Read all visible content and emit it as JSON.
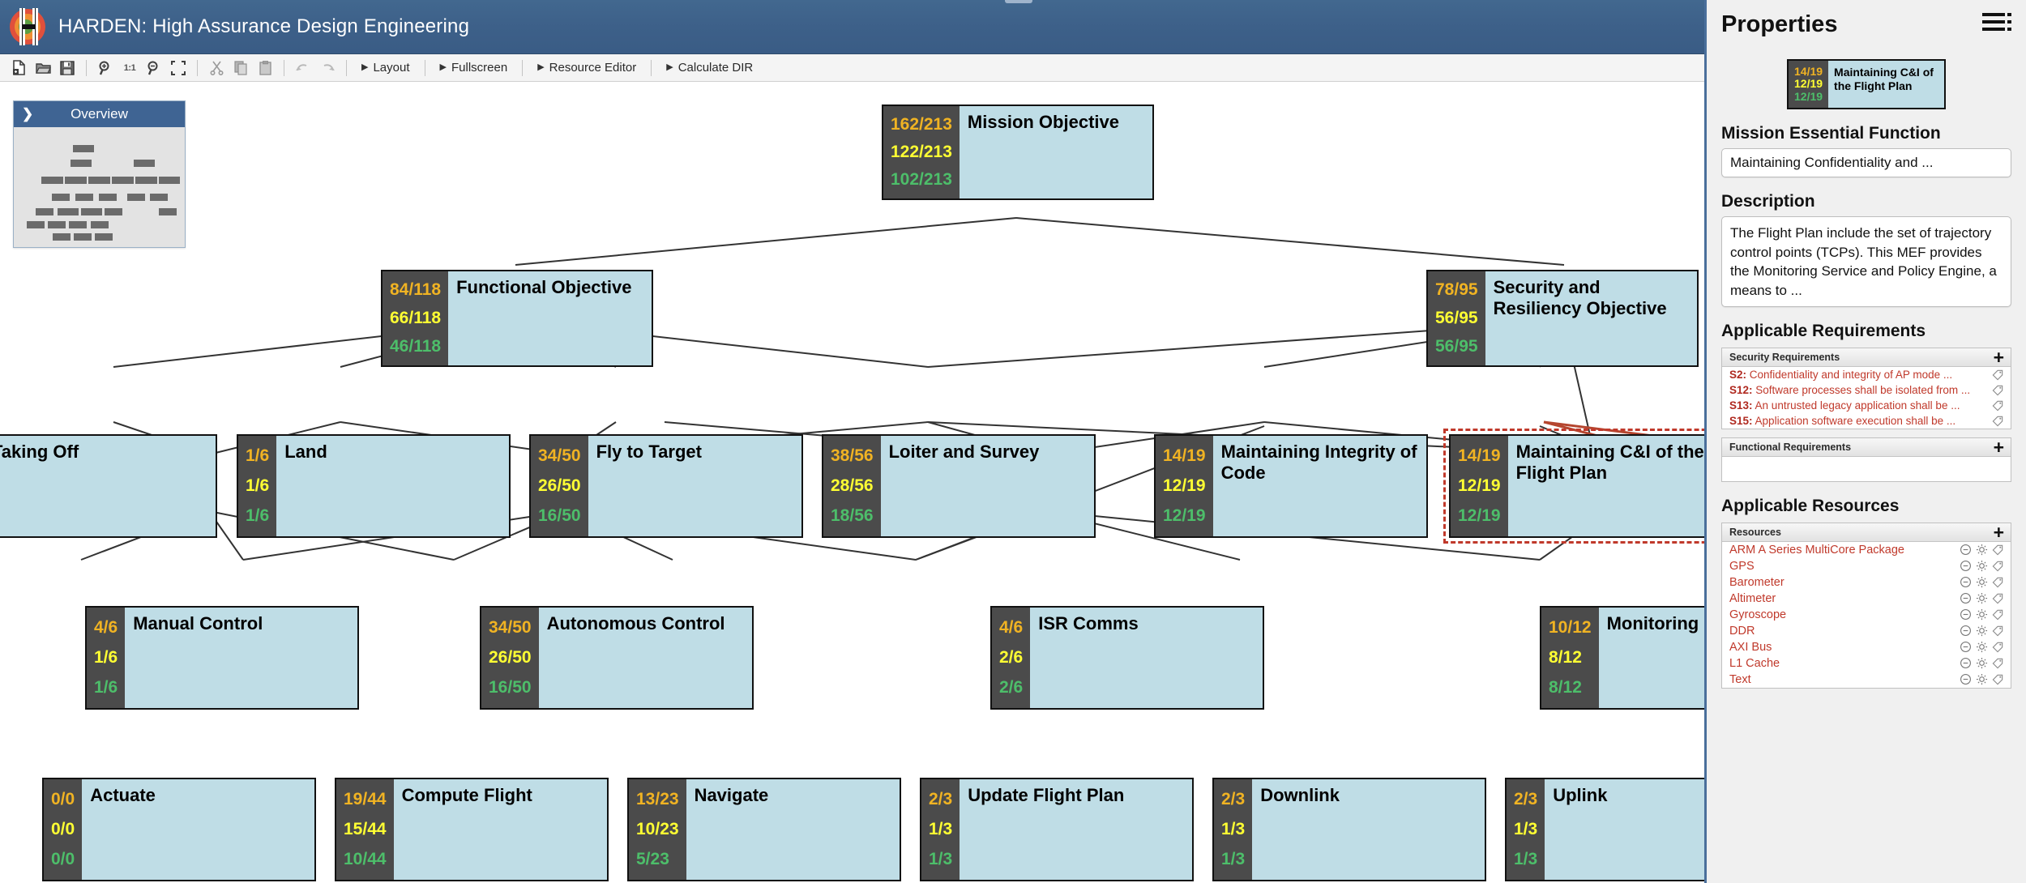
{
  "app": {
    "title": "HARDEN: High Assurance Design Engineering",
    "logo_icon": "harden-logo-icon"
  },
  "toolbar": {
    "icon_buttons": [
      {
        "name": "new-file-icon",
        "tooltip": "New"
      },
      {
        "name": "open-folder-icon",
        "tooltip": "Open"
      },
      {
        "name": "save-disk-icon",
        "tooltip": "Save"
      },
      {
        "name": "zoom-in-icon",
        "tooltip": "Zoom In"
      },
      {
        "name": "zoom-actual-size-icon",
        "tooltip": "1:1",
        "text": "1:1"
      },
      {
        "name": "zoom-out-icon",
        "tooltip": "Zoom Out"
      },
      {
        "name": "fit-to-screen-icon",
        "tooltip": "Fit"
      },
      {
        "name": "cut-scissors-icon",
        "tooltip": "Cut"
      },
      {
        "name": "copy-icon",
        "tooltip": "Copy"
      },
      {
        "name": "paste-icon",
        "tooltip": "Paste"
      },
      {
        "name": "undo-icon",
        "tooltip": "Undo"
      },
      {
        "name": "redo-icon",
        "tooltip": "Redo"
      }
    ],
    "menus": [
      {
        "label": "Layout"
      },
      {
        "label": "Fullscreen"
      },
      {
        "label": "Resource Editor"
      },
      {
        "label": "Calculate DIR"
      }
    ]
  },
  "overview": {
    "title": "Overview",
    "chevron_icon": "chevron-right-icon"
  },
  "diagram": {
    "nodes": [
      {
        "id": "mission-objective",
        "label": "Mission Objective",
        "m1": "162/213",
        "m2": "122/213",
        "m3": "102/213"
      },
      {
        "id": "functional-objective",
        "label": "Functional Objective",
        "m1": "84/118",
        "m2": "66/118",
        "m3": "46/118"
      },
      {
        "id": "security-resiliency-objective",
        "label": "Security and Resiliency Objective",
        "m1": "78/95",
        "m2": "56/95",
        "m3": "56/95"
      },
      {
        "id": "taking-off",
        "label": "Taking Off",
        "m1": "",
        "m2": "",
        "m3": ""
      },
      {
        "id": "land",
        "label": "Land",
        "m1": "1/6",
        "m2": "1/6",
        "m3": "1/6"
      },
      {
        "id": "fly-to-target",
        "label": "Fly to Target",
        "m1": "34/50",
        "m2": "26/50",
        "m3": "16/50"
      },
      {
        "id": "loiter-and-survey",
        "label": "Loiter and Survey",
        "m1": "38/56",
        "m2": "28/56",
        "m3": "18/56"
      },
      {
        "id": "maintaining-integrity-of-code",
        "label": "Maintaining Integrity of Code",
        "m1": "14/19",
        "m2": "12/19",
        "m3": "12/19"
      },
      {
        "id": "maintaining-ci-flight-plan",
        "label": "Maintaining C&I of the Flight Plan",
        "m1": "14/19",
        "m2": "12/19",
        "m3": "12/19",
        "selected": true
      },
      {
        "id": "manual-control",
        "label": "Manual Control",
        "m1": "4/6",
        "m2": "1/6",
        "m3": "1/6"
      },
      {
        "id": "autonomous-control",
        "label": "Autonomous Control",
        "m1": "34/50",
        "m2": "26/50",
        "m3": "16/50"
      },
      {
        "id": "isr-comms",
        "label": "ISR Comms",
        "m1": "4/6",
        "m2": "2/6",
        "m3": "2/6"
      },
      {
        "id": "monitoring",
        "label": "Monitoring",
        "m1": "10/12",
        "m2": "8/12",
        "m3": "8/12"
      },
      {
        "id": "actuate",
        "label": "Actuate",
        "m1": "0/0",
        "m2": "0/0",
        "m3": "0/0"
      },
      {
        "id": "compute-flight",
        "label": "Compute Flight",
        "m1": "19/44",
        "m2": "15/44",
        "m3": "10/44"
      },
      {
        "id": "navigate",
        "label": "Navigate",
        "m1": "13/23",
        "m2": "10/23",
        "m3": "5/23"
      },
      {
        "id": "update-flight-plan",
        "label": "Update Flight Plan",
        "m1": "2/3",
        "m2": "1/3",
        "m3": "1/3"
      },
      {
        "id": "downlink",
        "label": "Downlink",
        "m1": "2/3",
        "m2": "1/3",
        "m3": "1/3"
      },
      {
        "id": "uplink",
        "label": "Uplink",
        "m1": "2/3",
        "m2": "1/3",
        "m3": "1/3"
      }
    ]
  },
  "properties": {
    "title": "Properties",
    "menu_icon": "hamburger-menu-icon",
    "preview": {
      "label": "Maintaining C&I of the Flight Plan",
      "m1": "14/19",
      "m2": "12/19",
      "m3": "12/19"
    },
    "mef": {
      "heading": "Mission Essential Function",
      "value": "Maintaining Confidentiality and ..."
    },
    "description": {
      "heading": "Description",
      "value": "The Flight Plan include the set of trajectory control points (TCPs). This MEF provides the Monitoring Service and Policy Engine, a means to ..."
    },
    "applicable_requirements": {
      "heading": "Applicable Requirements",
      "groups": [
        {
          "name": "security-requirements",
          "header": "Security Requirements",
          "add_icon": "plus-icon",
          "items": [
            {
              "id": "S2:",
              "text": "Confidentiality and integrity of AP mode ...",
              "tag_icon": "tag-icon"
            },
            {
              "id": "S12:",
              "text": "Software processes shall be isolated from  ...",
              "tag_icon": "tag-icon"
            },
            {
              "id": "S13:",
              "text": "An untrusted legacy application shall be  ...",
              "tag_icon": "tag-icon"
            },
            {
              "id": "S15:",
              "text": "Application software execution shall be ...",
              "tag_icon": "tag-icon"
            }
          ]
        },
        {
          "name": "functional-requirements",
          "header": "Functional Requirements",
          "add_icon": "plus-icon",
          "items": []
        }
      ]
    },
    "applicable_resources": {
      "heading": "Applicable Resources",
      "header": "Resources",
      "add_icon": "plus-icon",
      "items": [
        {
          "text": "ARM A Series MultiCore Package"
        },
        {
          "text": "GPS"
        },
        {
          "text": "Barometer"
        },
        {
          "text": "Altimeter"
        },
        {
          "text": "Gyroscope"
        },
        {
          "text": "DDR"
        },
        {
          "text": "AXI Bus"
        },
        {
          "text": "L1 Cache"
        },
        {
          "text": "Text"
        }
      ],
      "row_icons": [
        "minus-circle-icon",
        "gear-icon",
        "tag-icon"
      ]
    }
  },
  "colors": {
    "titlebar": "#3d6089",
    "node_fill": "#bfdde6",
    "node_metrics_bg": "#4b4b4b",
    "metric_orange": "#f0b323",
    "metric_yellow": "#ffff33",
    "metric_green": "#4dbe6a",
    "selection": "#c0392b",
    "accent_red": "#c0392b"
  }
}
